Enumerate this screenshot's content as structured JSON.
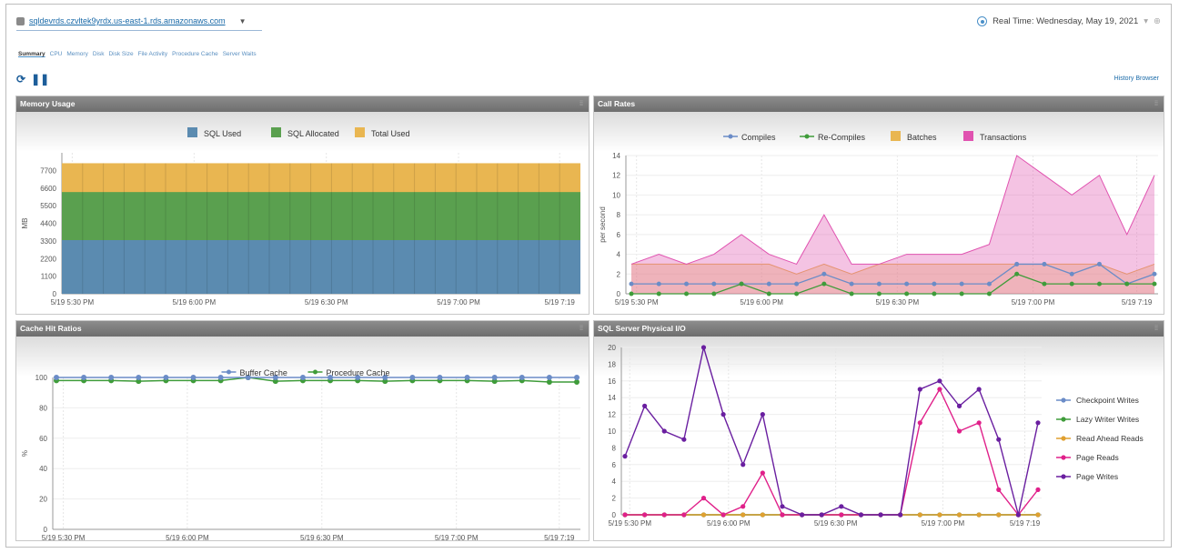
{
  "header": {
    "server_name": "sqldevrds.czvltek9yrdx.us-east-1.rds.amazonaws.com",
    "realtime_label": "Real Time: Wednesday, May 19, 2021",
    "history_browser": "History Browser"
  },
  "tabs": [
    {
      "label": "Summary"
    },
    {
      "label": "CPU"
    },
    {
      "label": "Memory"
    },
    {
      "label": "Disk"
    },
    {
      "label": "Disk Size"
    },
    {
      "label": "File Activity"
    },
    {
      "label": "Procedure Cache"
    },
    {
      "label": "Server Waits"
    }
  ],
  "panels": {
    "memory": {
      "title": "Memory Usage"
    },
    "callrates": {
      "title": "Call Rates"
    },
    "cache": {
      "title": "Cache Hit Ratios"
    },
    "io": {
      "title": "SQL Server Physical I/O"
    }
  },
  "chart_data": [
    {
      "id": "memory",
      "type": "area",
      "title": "",
      "ylabel": "MB",
      "ylim": [
        0,
        8800
      ],
      "yticks": [
        0,
        1100,
        2200,
        3300,
        4400,
        5500,
        6600,
        7700
      ],
      "xlabels": [
        "5/19 5:30 PM",
        "5/19 6:00 PM",
        "5/19 6:30 PM",
        "5/19 7:00 PM",
        "5/19 7:19"
      ],
      "legend": "top-center",
      "series": [
        {
          "name": "SQL Used",
          "value": 3350,
          "color": "#5b8bb0"
        },
        {
          "name": "SQL Allocated",
          "value": 6350,
          "color": "#5aa04f"
        },
        {
          "name": "Total Used",
          "value": 8150,
          "color": "#e9b651"
        }
      ]
    },
    {
      "id": "callrates",
      "type": "line",
      "title": "",
      "ylabel": "per second",
      "ylim": [
        0,
        14
      ],
      "yticks": [
        0,
        2,
        4,
        6,
        8,
        10,
        12,
        14
      ],
      "xlabels": [
        "5/19 5:30 PM",
        "5/19 6:00 PM",
        "5/19 6:30 PM",
        "5/19 7:00 PM",
        "5/19 7:19"
      ],
      "legend": "top-center",
      "series": [
        {
          "name": "Compiles",
          "color": "#6b8cc7",
          "style": "line",
          "values": [
            1,
            1,
            1,
            1,
            1,
            1,
            1,
            2,
            1,
            1,
            1,
            1,
            1,
            1,
            3,
            3,
            2,
            3,
            1,
            2
          ]
        },
        {
          "name": "Re-Compiles",
          "color": "#3f9c3a",
          "style": "line",
          "values": [
            0,
            0,
            0,
            0,
            1,
            0,
            0,
            1,
            0,
            0,
            0,
            0,
            0,
            0,
            2,
            1,
            1,
            1,
            1,
            1
          ]
        },
        {
          "name": "Batches",
          "color": "#e9b651",
          "style": "area",
          "values": [
            3,
            3,
            3,
            3,
            3,
            3,
            2,
            3,
            2,
            3,
            3,
            3,
            3,
            3,
            3,
            3,
            3,
            3,
            2,
            3
          ]
        },
        {
          "name": "Transactions",
          "color": "#e052b0",
          "style": "area",
          "values": [
            3,
            4,
            3,
            4,
            6,
            4,
            3,
            8,
            3,
            3,
            4,
            4,
            4,
            5,
            14,
            12,
            10,
            12,
            6,
            12
          ]
        }
      ]
    },
    {
      "id": "cache",
      "type": "line",
      "title": "",
      "ylabel": "%",
      "ylim": [
        0,
        100
      ],
      "yticks": [
        0,
        20,
        40,
        60,
        80,
        100
      ],
      "xlabels": [
        "5/19 5:30 PM",
        "5/19 6:00 PM",
        "5/19 6:30 PM",
        "5/19 7:00 PM",
        "5/19 7:19"
      ],
      "legend": "top-center",
      "series": [
        {
          "name": "Buffer Cache",
          "color": "#6b8cc7",
          "values": [
            100,
            100,
            100,
            100,
            100,
            100,
            100,
            100,
            100,
            100,
            100,
            100,
            100,
            100,
            100,
            100,
            100,
            100,
            100,
            100
          ]
        },
        {
          "name": "Procedure Cache",
          "color": "#3f9c3a",
          "values": [
            98,
            98,
            98,
            97.5,
            98,
            98,
            98,
            100,
            97.5,
            98,
            98,
            98,
            97.5,
            98,
            98,
            98,
            97.5,
            98,
            97,
            97
          ]
        }
      ]
    },
    {
      "id": "io",
      "type": "line",
      "title": "",
      "ylabel": "",
      "ylim": [
        0,
        20
      ],
      "yticks": [
        0,
        2,
        4,
        6,
        8,
        10,
        12,
        14,
        16,
        18,
        20
      ],
      "xlabels": [
        "5/19 5:30 PM",
        "5/19 6:00 PM",
        "5/19 6:30 PM",
        "5/19 7:00 PM",
        "5/19 7:19"
      ],
      "legend": "right",
      "series": [
        {
          "name": "Checkpoint Writes",
          "color": "#6b8cc7",
          "values": [
            0,
            0,
            0,
            0,
            0,
            0,
            0,
            0,
            0,
            0,
            0,
            0,
            0,
            0,
            0,
            0,
            0,
            0,
            0,
            0,
            0,
            0
          ]
        },
        {
          "name": "Lazy Writer Writes",
          "color": "#3f9c3a",
          "values": [
            0,
            0,
            0,
            0,
            0,
            0,
            0,
            0,
            0,
            0,
            0,
            0,
            0,
            0,
            0,
            0,
            0,
            0,
            0,
            0,
            0,
            0
          ]
        },
        {
          "name": "Read Ahead Reads",
          "color": "#e0a030",
          "values": [
            0,
            0,
            0,
            0,
            0,
            0,
            0,
            0,
            0,
            0,
            0,
            0,
            0,
            0,
            0,
            0,
            0,
            0,
            0,
            0,
            0,
            0
          ]
        },
        {
          "name": "Page Reads",
          "color": "#e0208a",
          "values": [
            0,
            0,
            0,
            0,
            2,
            0,
            1,
            5,
            0,
            0,
            0,
            0,
            0,
            0,
            0,
            11,
            15,
            10,
            11,
            3,
            0,
            3
          ]
        },
        {
          "name": "Page Writes",
          "color": "#6a1fa0",
          "values": [
            7,
            13,
            10,
            9,
            20,
            12,
            6,
            12,
            1,
            0,
            0,
            1,
            0,
            0,
            0,
            15,
            16,
            13,
            15,
            9,
            0,
            11
          ]
        }
      ]
    }
  ]
}
